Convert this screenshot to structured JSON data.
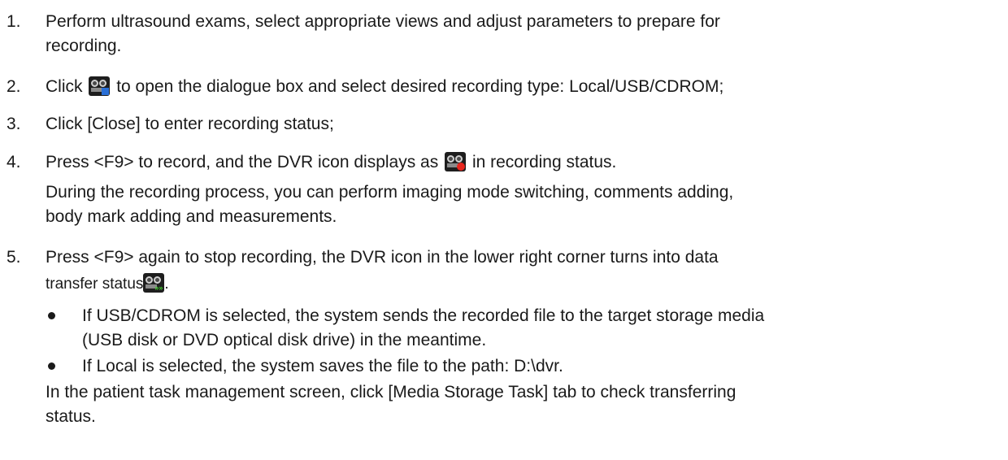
{
  "steps": [
    {
      "number": "1.",
      "lines": [
        "Perform ultrasound exams, select appropriate views and adjust parameters to prepare for",
        "recording."
      ]
    },
    {
      "number": "2.",
      "before": "Click",
      "after": "to open the dialogue box and select desired recording type: Local/USB/CDROM;",
      "icon": "dvr-select-icon",
      "icon_color": "#2a6fd6"
    },
    {
      "number": "3.",
      "text": "Click [Close] to enter recording status;"
    },
    {
      "number": "4.",
      "before": "Press <F9> to record, and the DVR icon displays as",
      "after": "in recording status.",
      "icon": "dvr-recording-icon",
      "icon_color": "#e8261e",
      "note_lines": [
        "During the recording process, you can perform imaging mode switching, comments adding,",
        "body mark adding and measurements."
      ]
    },
    {
      "number": "5.",
      "line1": "Press <F9> again to stop recording, the DVR icon in the lower right corner turns into data",
      "line2_before": "transfer status",
      "line2_after": ".",
      "icon": "dvr-transfer-icon",
      "icon_color": "#43d12e"
    }
  ],
  "bullets": [
    {
      "lines": [
        "If USB/CDROM is selected, the system sends the recorded file to the target storage media",
        "(USB disk or DVD optical disk drive) in the meantime."
      ]
    },
    {
      "lines": [
        "If Local is selected, the system saves the file to the path: D:\\dvr."
      ]
    }
  ],
  "footer_lines": [
    "In the patient task management screen, click [Media Storage Task] tab to check transferring",
    "status."
  ]
}
